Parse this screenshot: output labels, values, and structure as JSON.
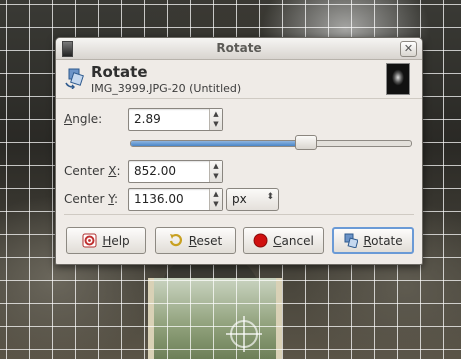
{
  "dialog": {
    "window_title": "Rotate",
    "close_glyph": "✕",
    "header": {
      "title": "Rotate",
      "subtitle": "IMG_3999.JPG-20 (Untitled)"
    }
  },
  "angle": {
    "label_mnemonic": "A",
    "label_rest": "ngle:",
    "value": "2.89",
    "slider_fraction": 0.62
  },
  "center_x": {
    "label_pre": "Center ",
    "label_mnemonic": "X",
    "label_post": ":",
    "value": "852.00"
  },
  "center_y": {
    "label_pre": "Center ",
    "label_mnemonic": "Y",
    "label_post": ":",
    "value": "1136.00",
    "unit": "px"
  },
  "buttons": {
    "help": {
      "mnemonic": "H",
      "rest": "elp"
    },
    "reset": {
      "mnemonic": "R",
      "rest": "eset"
    },
    "cancel": {
      "mnemonic": "C",
      "rest": "ancel"
    },
    "rotate": {
      "mnemonic": "R",
      "rest": "otate"
    }
  },
  "icons": {
    "window": "gimp-window-icon",
    "tool": "rotate-tool-icon",
    "help": "help-icon",
    "reset": "reset-icon",
    "cancel": "cancel-icon",
    "rotate": "rotate-icon"
  },
  "colors": {
    "dialog_bg": "#efebe7",
    "accent": "#4a86c8",
    "cancel_red": "#d01010"
  }
}
